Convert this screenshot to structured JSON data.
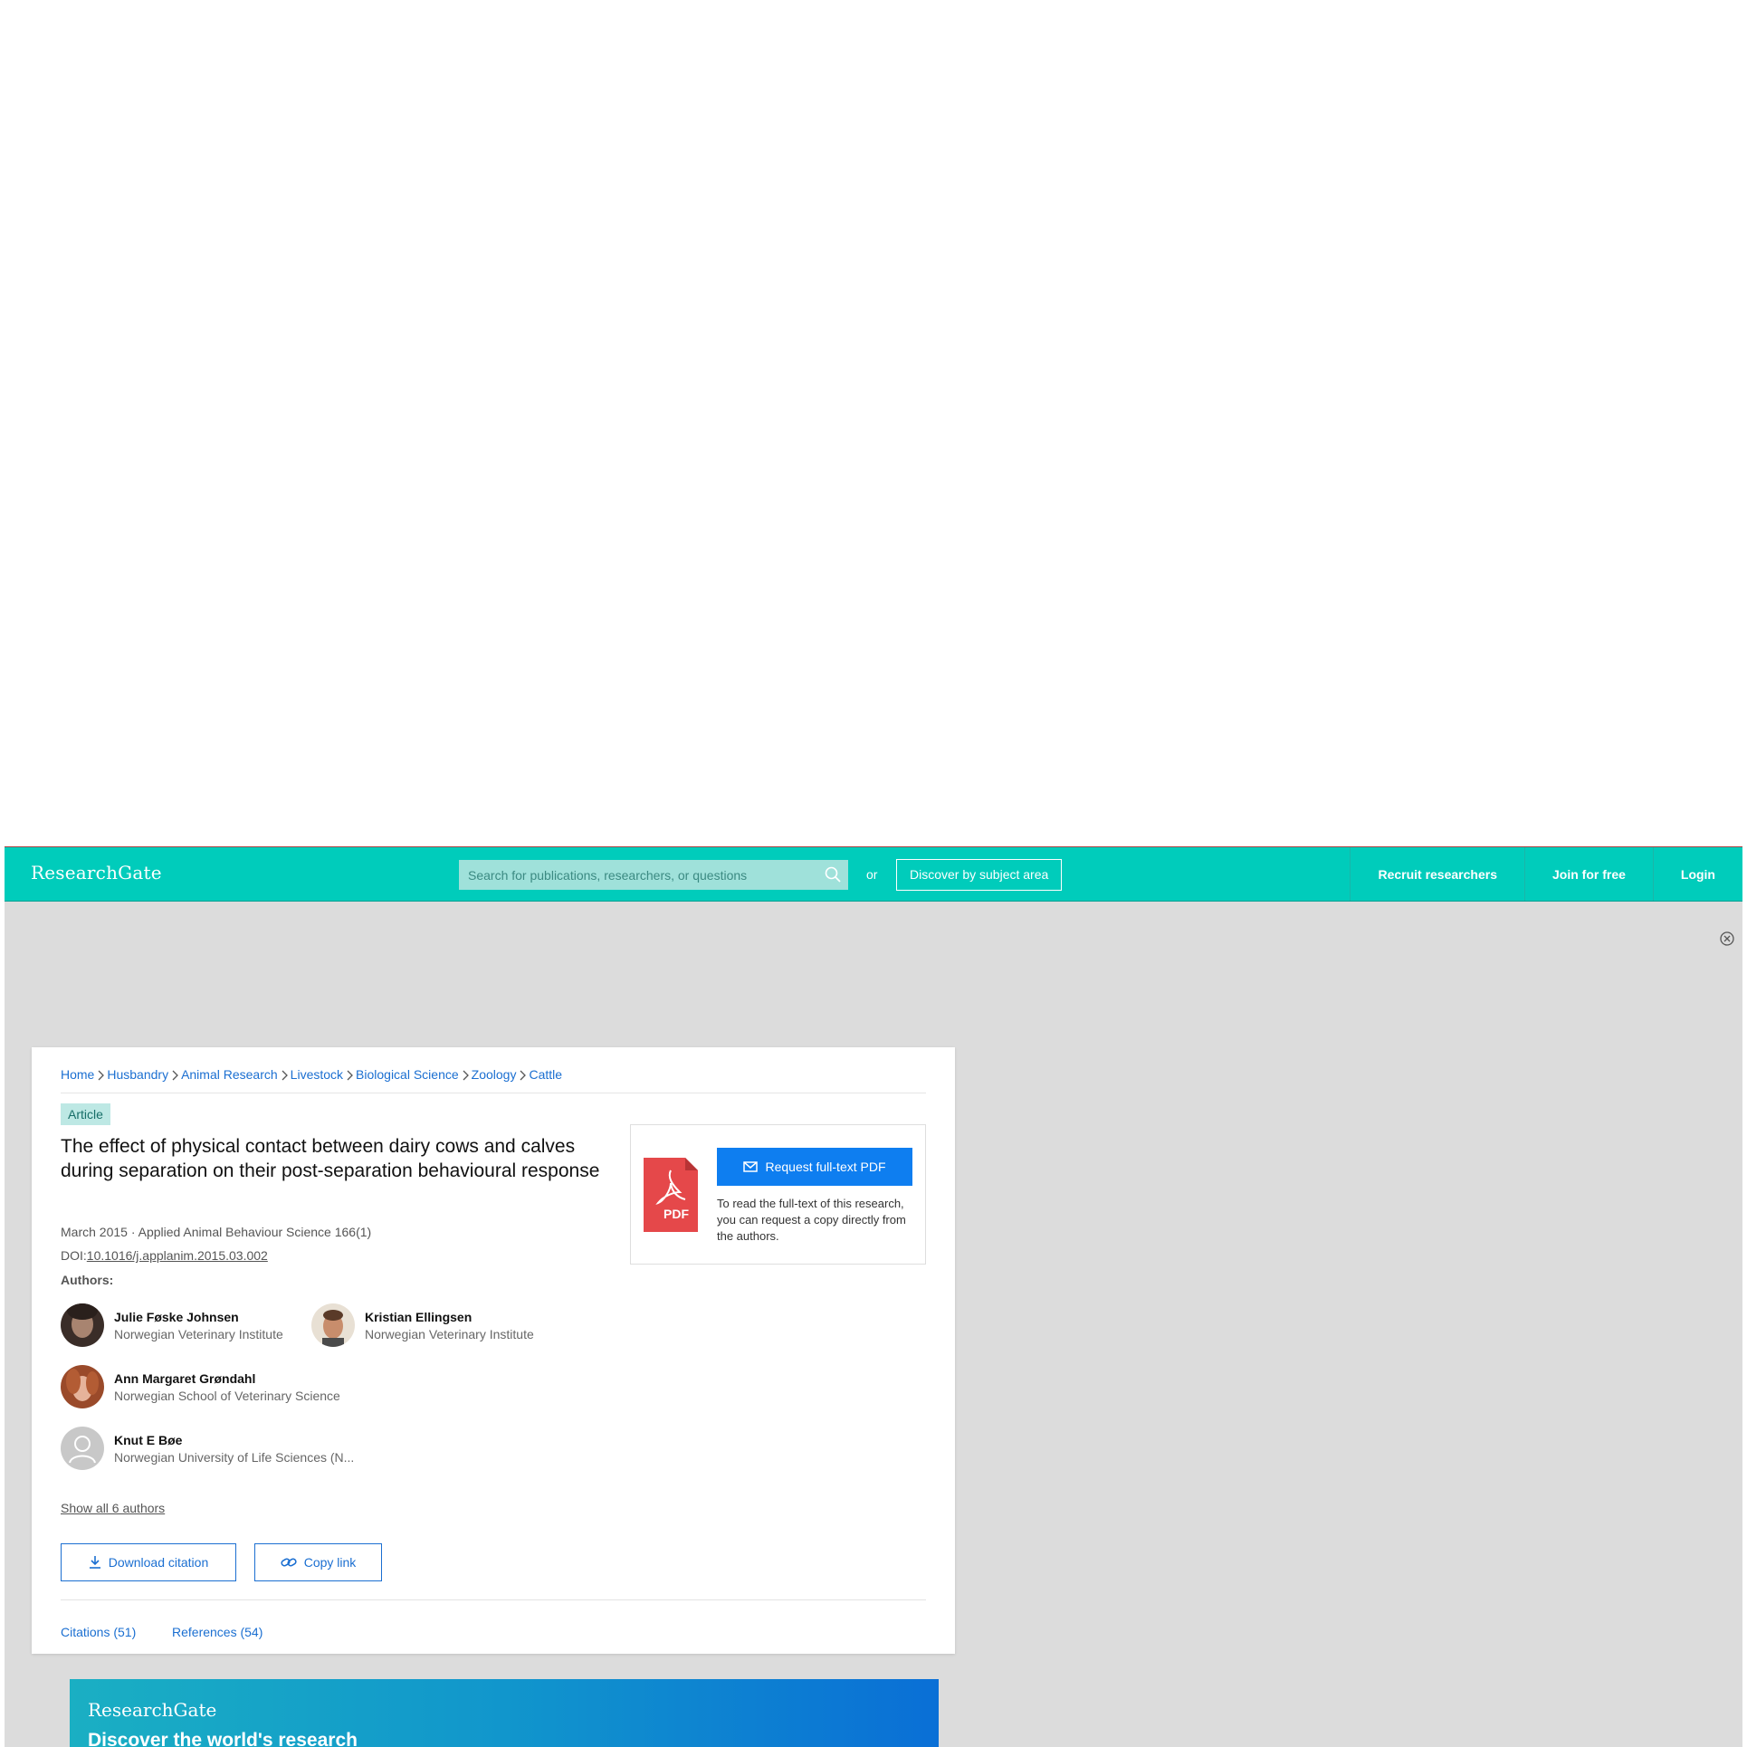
{
  "header": {
    "logo": "ResearchGate",
    "search_placeholder": "Search for publications, researchers, or questions",
    "or_text": "or",
    "discover_label": "Discover by subject area",
    "nav": [
      "Recruit researchers",
      "Join for free",
      "Login"
    ]
  },
  "breadcrumb": [
    "Home",
    "Husbandry",
    "Animal Research",
    "Livestock",
    "Biological Science",
    "Zoology",
    "Cattle"
  ],
  "article": {
    "badge": "Article",
    "title": "The effect of physical contact between dairy cows and calves during separation on their post-separation behavioural response",
    "meta": "March 2015 · Applied Animal Behaviour Science 166(1)",
    "doi_label": "DOI:",
    "doi": "10.1016/j.applanim.2015.03.002",
    "authors_label": "Authors:",
    "authors": [
      {
        "name": "Julie Føske Johnsen",
        "affiliation": "Norwegian Veterinary Institute"
      },
      {
        "name": "Kristian Ellingsen",
        "affiliation": "Norwegian Veterinary Institute"
      },
      {
        "name": "Ann Margaret Grøndahl",
        "affiliation": "Norwegian School of Veterinary Science"
      },
      {
        "name": "Knut E Bøe",
        "affiliation": "Norwegian University of Life Sciences (N..."
      }
    ],
    "show_all": "Show all 6 authors",
    "download_citation": "Download citation",
    "copy_link": "Copy link",
    "tabs": [
      "Citations (51)",
      "References (54)"
    ]
  },
  "pdf_box": {
    "pdf_label": "PDF",
    "request_label": "Request full-text PDF",
    "note": "To read the full-text of this research, you can request a copy directly from the authors."
  },
  "promo": {
    "logo": "ResearchGate",
    "heading": "Discover the world's research"
  },
  "colors": {
    "header": "#00ccbb",
    "link": "#1b6fd1",
    "primary_button": "#0e7ef0",
    "pdf_red": "#e5484a"
  }
}
